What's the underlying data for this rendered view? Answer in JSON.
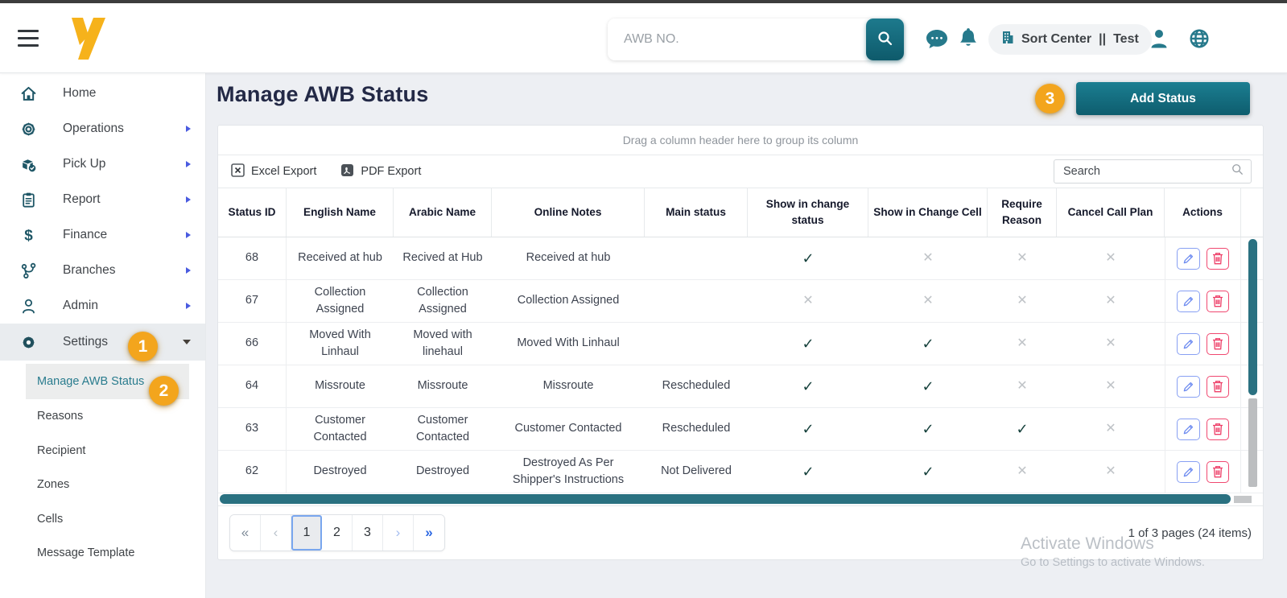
{
  "topbar": {
    "search_placeholder": "AWB NO.",
    "station": {
      "name": "Sort Center",
      "separator": "||",
      "env": "Test"
    }
  },
  "sidebar": {
    "items": [
      {
        "label": "Home",
        "icon": "home-icon",
        "expandable": false
      },
      {
        "label": "Operations",
        "icon": "operations-icon",
        "expandable": true
      },
      {
        "label": "Pick Up",
        "icon": "pickup-icon",
        "expandable": true
      },
      {
        "label": "Report",
        "icon": "report-icon",
        "expandable": true
      },
      {
        "label": "Finance",
        "icon": "finance-icon",
        "expandable": true
      },
      {
        "label": "Branches",
        "icon": "branches-icon",
        "expandable": true
      },
      {
        "label": "Admin",
        "icon": "admin-icon",
        "expandable": true
      }
    ],
    "settings": {
      "label": "Settings",
      "icon": "settings-icon",
      "expanded": true
    },
    "submenu": [
      {
        "label": "Manage AWB Status",
        "active": true
      },
      {
        "label": "Reasons",
        "active": false
      },
      {
        "label": "Recipient",
        "active": false
      },
      {
        "label": "Zones",
        "active": false
      },
      {
        "label": "Cells",
        "active": false
      },
      {
        "label": "Message Template",
        "active": false
      }
    ]
  },
  "annotations": {
    "step1": "1",
    "step2": "2",
    "step3": "3"
  },
  "page": {
    "title": "Manage AWB Status",
    "add_status_button": "Add Status",
    "group_hint": "Drag a column header here to group its column",
    "excel_export_label": "Excel Export",
    "pdf_export_label": "PDF Export",
    "table_search_placeholder": "Search"
  },
  "table": {
    "columns": [
      "Status ID",
      "English Name",
      "Arabic Name",
      "Online Notes",
      "Main status",
      "Show in change status",
      "Show in Change Cell",
      "Require Reason",
      "Cancel Call Plan",
      "Actions"
    ],
    "flag_true_glyph": "✓",
    "flag_false_glyph": "✕",
    "rows": [
      {
        "status_id": "68",
        "english_name": "Received at hub",
        "arabic_name": "Recived at Hub",
        "online_notes": "Received at hub",
        "main_status": "",
        "show_in_change_status": true,
        "show_in_change_cell": false,
        "require_reason": false,
        "cancel_call_plan": false
      },
      {
        "status_id": "67",
        "english_name": "Collection Assigned",
        "arabic_name": "Collection Assigned",
        "online_notes": "Collection Assigned",
        "main_status": "",
        "show_in_change_status": false,
        "show_in_change_cell": false,
        "require_reason": false,
        "cancel_call_plan": false
      },
      {
        "status_id": "66",
        "english_name": "Moved With Linhaul",
        "arabic_name": "Moved with linehaul",
        "online_notes": "Moved With Linhaul",
        "main_status": "",
        "show_in_change_status": true,
        "show_in_change_cell": true,
        "require_reason": false,
        "cancel_call_plan": false
      },
      {
        "status_id": "64",
        "english_name": "Missroute",
        "arabic_name": "Missroute",
        "online_notes": "Missroute",
        "main_status": "Rescheduled",
        "show_in_change_status": true,
        "show_in_change_cell": true,
        "require_reason": false,
        "cancel_call_plan": false
      },
      {
        "status_id": "63",
        "english_name": "Customer Contacted",
        "arabic_name": "Customer Contacted",
        "online_notes": "Customer Contacted",
        "main_status": "Rescheduled",
        "show_in_change_status": true,
        "show_in_change_cell": true,
        "require_reason": true,
        "cancel_call_plan": false
      },
      {
        "status_id": "62",
        "english_name": "Destroyed",
        "arabic_name": "Destroyed",
        "online_notes": "Destroyed As Per Shipper's Instructions",
        "main_status": "Not Delivered",
        "show_in_change_status": true,
        "show_in_change_cell": true,
        "require_reason": false,
        "cancel_call_plan": false
      }
    ]
  },
  "pagination": {
    "buttons": [
      {
        "label": "«",
        "state": "nav-muted"
      },
      {
        "label": "‹",
        "state": "nav-faint"
      },
      {
        "label": "1",
        "state": "active"
      },
      {
        "label": "2",
        "state": "page"
      },
      {
        "label": "3",
        "state": "page"
      },
      {
        "label": "›",
        "state": "nav-light"
      },
      {
        "label": "»",
        "state": "nav-strong"
      }
    ],
    "summary": "1 of 3 pages (24 items)"
  },
  "watermark": {
    "line1": "Activate Windows",
    "line2": "Go to Settings to activate Windows."
  },
  "colors": {
    "teal": "#26798b",
    "teal_dark": "#0e5d6e",
    "accent_orange": "#f3a51d",
    "logo_yellow": "#f6b21b",
    "check_green": "#16413c",
    "cross_gray": "#bfc3c7",
    "edit_blue": "#88a0f3",
    "delete_pink": "#f04870",
    "scrollbar_teal": "#2a7181"
  }
}
